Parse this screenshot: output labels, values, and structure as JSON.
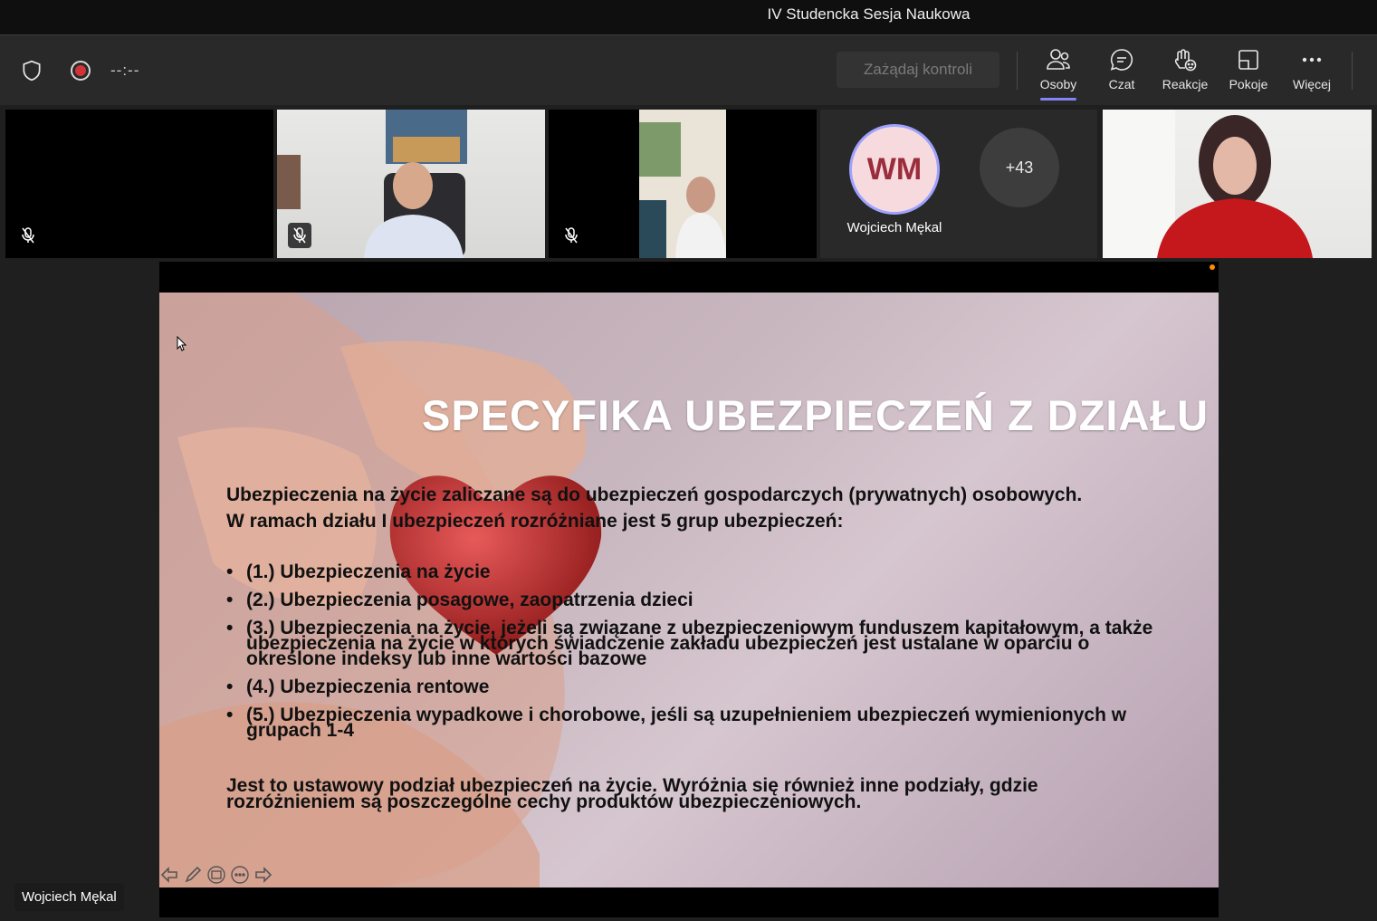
{
  "window": {
    "title": "IV Studencka Sesja Naukowa"
  },
  "toolbar": {
    "timer": "--:--",
    "request_control": "Zażądaj kontroli",
    "items": [
      {
        "label": "Osoby",
        "icon": "people-icon",
        "active": true
      },
      {
        "label": "Czat",
        "icon": "chat-icon"
      },
      {
        "label": "Reakcje",
        "icon": "reactions-icon"
      },
      {
        "label": "Pokoje",
        "icon": "rooms-icon"
      },
      {
        "label": "Więcej",
        "icon": "more-icon"
      }
    ]
  },
  "participants": {
    "avatar_initials": "WM",
    "avatar_name": "Wojciech Mękal",
    "overflow_count": "+43"
  },
  "slide": {
    "title": "SPECYFIKA UBEZPIECZEŃ Z DZIAŁU I",
    "intro_line1": "Ubezpieczenia na życie zaliczane są do ubezpieczeń gospodarczych (prywatnych) osobowych.",
    "intro_line2": "W ramach działu I ubezpieczeń rozróżniane jest 5 grup ubezpieczeń:",
    "bullets": [
      "(1.) Ubezpieczenia na życie",
      "(2.) Ubezpieczenia posagowe, zaopatrzenia dzieci",
      "(3.) Ubezpieczenia na życie, jeżeli są związane z ubezpieczeniowym funduszem kapitałowym, a także ubezpieczenia na życie w których świadczenie zakładu ubezpieczeń jest ustalane w oparciu o określone indeksy lub inne wartości bazowe",
      "(4.) Ubezpieczenia rentowe",
      "(5.) Ubezpieczenia wypadkowe i chorobowe, jeśli są uzupełnieniem ubezpieczeń wymienionych w grupach 1-4"
    ],
    "footer": "Jest to ustawowy podział ubezpieczeń na życie. Wyróżnia się również inne podziały, gdzie rozróżnieniem są poszczególne cechy produktów ubezpieczeniowych."
  },
  "presenter_label": "Wojciech Mękal",
  "colors": {
    "accent": "#7f85f5",
    "record": "#d13438",
    "toolbar_bg": "#292929"
  }
}
